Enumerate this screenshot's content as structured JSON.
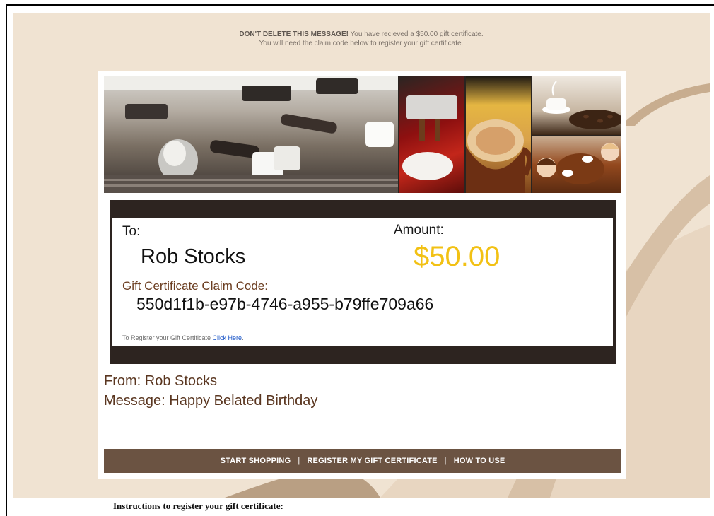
{
  "notice": {
    "bold": "DON'T DELETE THIS MESSAGE!",
    "text": " You have recieved a $50.00 gift certificate.",
    "line2": "You will need the claim code below to register your gift certificate."
  },
  "banner": {
    "images": [
      "espresso-machine-photo",
      "red-espresso-photo",
      "latte-cup-photo",
      "coffee-beans-cup-photo",
      "children-coffee-photo"
    ]
  },
  "certificate": {
    "to_label": "To:",
    "recipient": "Rob Stocks",
    "amount_label": "Amount:",
    "amount": "$50.00",
    "code_label": "Gift Certificate Claim Code:",
    "code": "550d1f1b-e97b-4746-a955-b79ffe709a66",
    "register_text": "To Register your Gift Certificate ",
    "register_link": "Click Here",
    "register_end": "."
  },
  "from_line": "From: Rob Stocks",
  "message_line": "Message: Happy Belated Birthday",
  "nav": {
    "start_shopping": "START SHOPPING",
    "register": "REGISTER MY GIFT CERTIFICATE",
    "how_to_use": "HOW TO USE",
    "separator": "|"
  },
  "instructions": "Instructions to register your gift certificate:",
  "colors": {
    "background": "#f0e3d2",
    "dark_bar": "#2d2420",
    "nav_bar": "#6b5342",
    "amount": "#f2c114",
    "link": "#1a55c8"
  }
}
